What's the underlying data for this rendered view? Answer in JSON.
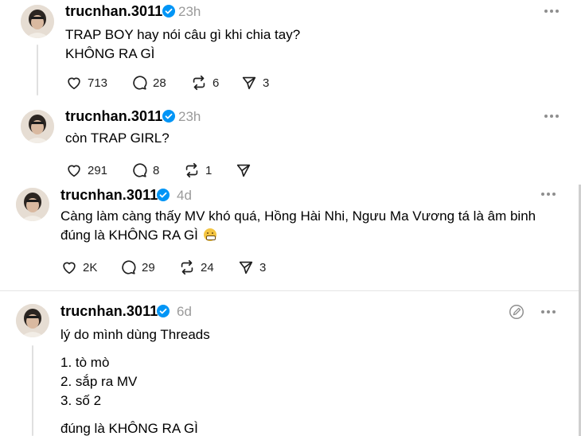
{
  "posts": [
    {
      "username": "trucnhan.3011",
      "time": "23h",
      "lines": [
        "TRAP BOY hay nói câu gì khi chia tay?",
        "KHÔNG RA GÌ"
      ],
      "likes": "713",
      "comments": "28",
      "reposts": "6",
      "shares": "3"
    },
    {
      "username": "trucnhan.3011",
      "time": "23h",
      "lines": [
        "còn TRAP GIRL?"
      ],
      "likes": "291",
      "comments": "8",
      "reposts": "1",
      "shares": ""
    },
    {
      "username": "trucnhan.3011",
      "time": "4d",
      "lines": [
        "Càng làm càng thấy MV khó quá, Hồng Hài Nhi, Ngưu Ma Vương tá là âm binh",
        "đúng là KHÔNG RA GÌ"
      ],
      "likes": "2K",
      "comments": "29",
      "reposts": "24",
      "shares": "3"
    },
    {
      "username": "trucnhan.3011",
      "time": "6d",
      "lines": [
        "lý do mình dùng Threads",
        "1. tò mò",
        "2. sắp ra MV",
        "3. số 2",
        "đúng là KHÔNG RA GÌ"
      ]
    }
  ],
  "icons": {
    "verified": "verified-badge-icon",
    "more": "more-options-icon",
    "like": "heart-icon",
    "comment": "comment-icon",
    "repost": "repost-icon",
    "share": "send-icon",
    "edit": "edit-icon",
    "emoji": "grimacing-emoji"
  },
  "colors": {
    "verified": "#0095f6",
    "muted": "#9a9a9a"
  }
}
